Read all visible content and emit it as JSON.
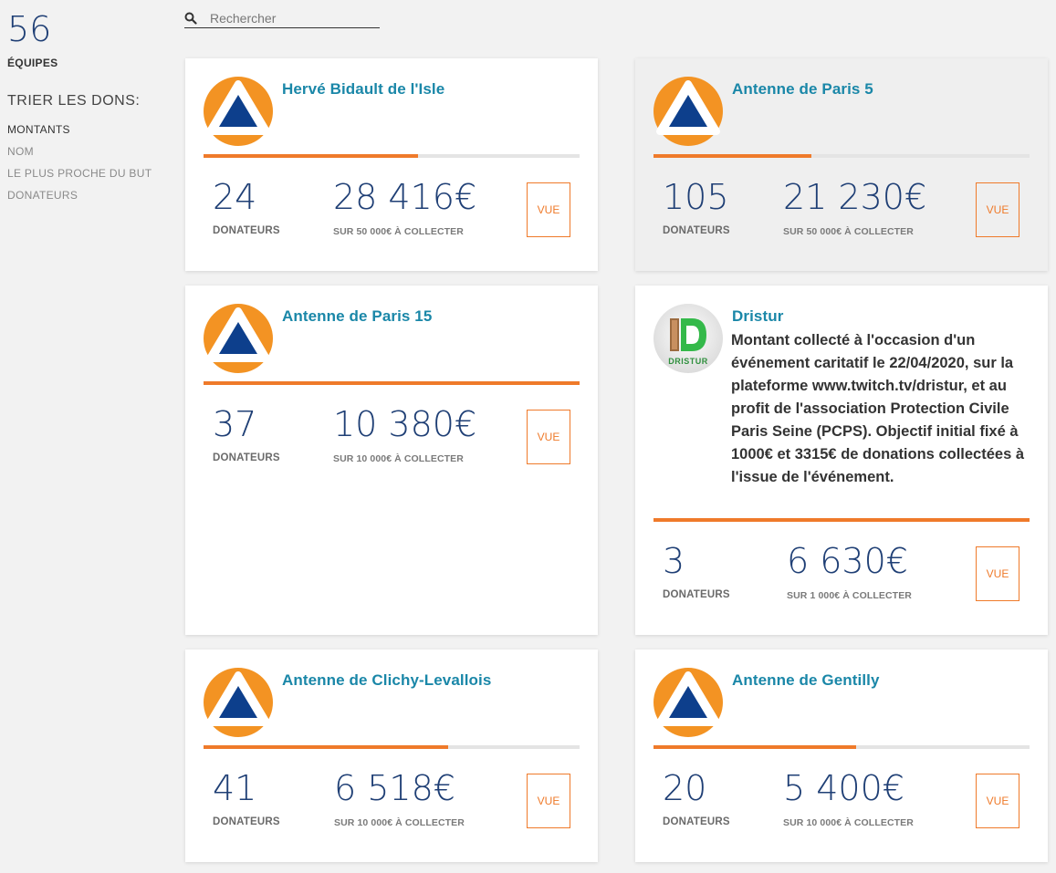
{
  "sidebar": {
    "team_count": "56",
    "team_label": "ÉQUIPES",
    "sort_title": "TRIER LES DONS:",
    "sort_options": [
      "MONTANTS",
      "NOM",
      "LE PLUS PROCHE DU BUT",
      "DONATEURS"
    ]
  },
  "search": {
    "placeholder": "Rechercher",
    "icon": "search-icon"
  },
  "colors": {
    "accent": "#ef7a2a",
    "title": "#1a87a8",
    "number": "#1f3f75"
  },
  "cards": [
    {
      "title": "Hervé Bidault de l'Isle",
      "description": "",
      "logo": "protection-civile-logo",
      "donors": "24",
      "donors_label": "DONATEURS",
      "amount": "28 416€",
      "goal_text": "SUR 50 000€ À COLLECTER",
      "progress": 0.57,
      "button": "VUE"
    },
    {
      "title": "Antenne de Paris 5",
      "description": "",
      "logo": "protection-civile-logo",
      "donors": "105",
      "donors_label": "DONATEURS",
      "amount": "21 230€",
      "goal_text": "SUR 50 000€ À COLLECTER",
      "progress": 0.42,
      "button": "VUE"
    },
    {
      "title": "Antenne de Paris 15",
      "description": "",
      "logo": "protection-civile-logo",
      "donors": "37",
      "donors_label": "DONATEURS",
      "amount": "10 380€",
      "goal_text": "SUR 10 000€ À COLLECTER",
      "progress": 1.0,
      "button": "VUE"
    },
    {
      "title": "Dristur",
      "description": "Montant collecté à l'occasion d'un événement caritatif le 22/04/2020, sur la plateforme www.twitch.tv/dristur, et au profit de l'association Protection Civile Paris Seine (PCPS). Objectif initial fixé à 1000€ et 3315€ de donations collectées à l'issue de l'événement.",
      "logo": "dristur-logo",
      "logo_text": "DRISTUR",
      "donors": "3",
      "donors_label": "DONATEURS",
      "amount": "6 630€",
      "goal_text": "SUR 1 000€ À COLLECTER",
      "progress": 1.0,
      "button": "VUE"
    },
    {
      "title": "Antenne de Clichy-Levallois",
      "description": "",
      "logo": "protection-civile-logo",
      "donors": "41",
      "donors_label": "DONATEURS",
      "amount": "6 518€",
      "goal_text": "SUR 10 000€ À COLLECTER",
      "progress": 0.65,
      "button": "VUE"
    },
    {
      "title": "Antenne de Gentilly",
      "description": "",
      "logo": "protection-civile-logo",
      "donors": "20",
      "donors_label": "DONATEURS",
      "amount": "5 400€",
      "goal_text": "SUR 10 000€ À COLLECTER",
      "progress": 0.54,
      "button": "VUE"
    }
  ]
}
